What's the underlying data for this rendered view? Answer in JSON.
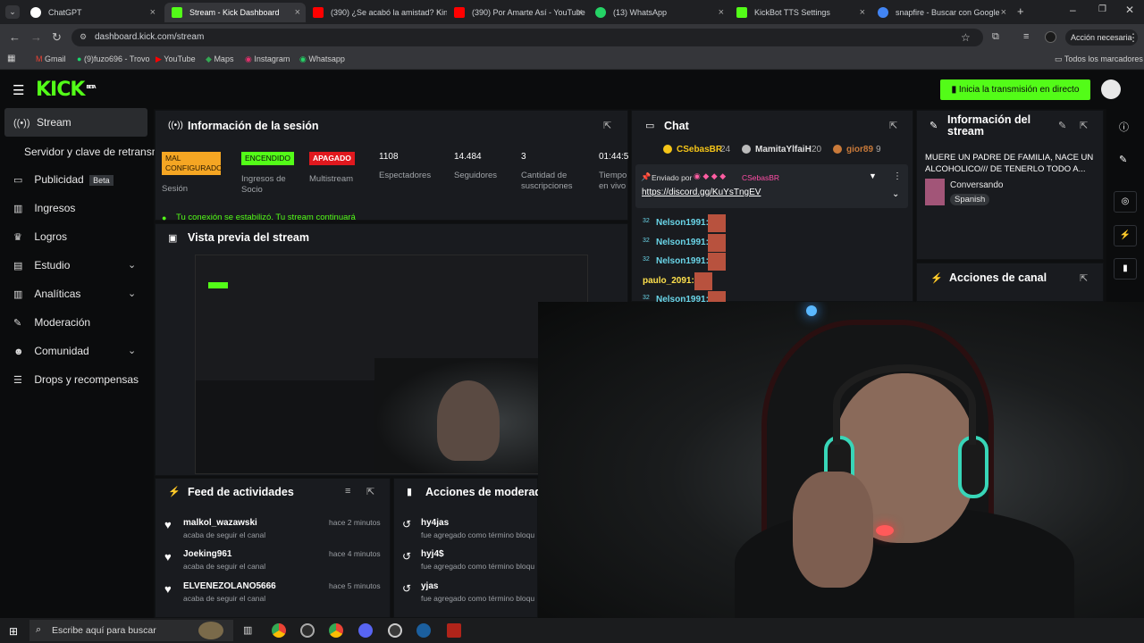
{
  "browser": {
    "tabs": [
      {
        "label": "ChatGPT",
        "color": "#cccccc"
      },
      {
        "label": "Stream - Kick Dashboard",
        "color": "#53fc18"
      },
      {
        "label": "(390) ¿Se acabó la amistad? Kin",
        "color": "#ff0000"
      },
      {
        "label": "(390) Por Amarte Así - YouTube",
        "color": "#ff0000"
      },
      {
        "label": "(13) WhatsApp",
        "color": "#25d366"
      },
      {
        "label": "KickBot TTS Settings",
        "color": "#53fc18"
      },
      {
        "label": "snapfire - Buscar con Google",
        "color": "#4285f4"
      }
    ],
    "url": "dashboard.kick.com/stream",
    "profile_button": "Acción necesaria",
    "bookmarks": [
      "Gmail",
      "(9)fuzo696 - Trovo",
      "YouTube",
      "Maps",
      "Instagram",
      "Whatsapp"
    ],
    "all_bookmarks": "Todos los marcadores"
  },
  "header": {
    "logo": "KICK",
    "logo_tag": "BETA",
    "go_live": "Inicia la transmisión en directo"
  },
  "sidebar": {
    "items": [
      {
        "label": "Stream",
        "icon": "broadcast-icon"
      },
      {
        "label": "Servidor y clave de retransm",
        "icon": ""
      },
      {
        "label": "Publicidad",
        "icon": "ad-icon",
        "badge": "Beta"
      },
      {
        "label": "Ingresos",
        "icon": "chart-icon"
      },
      {
        "label": "Logros",
        "icon": "trophy-icon"
      },
      {
        "label": "Estudio",
        "icon": "studio-icon"
      },
      {
        "label": "Analíticas",
        "icon": "analytics-icon"
      },
      {
        "label": "Moderación",
        "icon": "wrench-icon"
      },
      {
        "label": "Comunidad",
        "icon": "community-icon"
      },
      {
        "label": "Drops y recompensas",
        "icon": "drops-icon"
      }
    ]
  },
  "session": {
    "title": "Información de la sesión",
    "status": [
      {
        "badge": "MAL CONFIGURADO",
        "label": "Sesión"
      },
      {
        "badge": "ENCENDIDO",
        "label": "Ingresos de Socio"
      },
      {
        "badge": "APAGADO",
        "label": "Multistream"
      }
    ],
    "stats": [
      {
        "value": "1108",
        "label": "Espectadores"
      },
      {
        "value": "14.484",
        "label": "Seguidores"
      },
      {
        "value": "3",
        "label": "Cantidad de suscripciones"
      },
      {
        "value": "01:44:5",
        "label": "Tiempo en vivo"
      }
    ],
    "connection": "Tu conexión se estabilizó. Tu stream continuará"
  },
  "preview": {
    "title": "Vista previa del stream"
  },
  "chat": {
    "title": "Chat",
    "top_gifters": [
      {
        "name": "CSebasBR",
        "count": "24"
      },
      {
        "name": "MamitaYlfaiH",
        "count": "20"
      },
      {
        "name": "gior89",
        "count": "9"
      }
    ],
    "pinned": {
      "sent_by": "Enviado por",
      "sender": "CSebasBR",
      "link": "https://discord.gg/KuYsTngEV"
    },
    "messages": [
      {
        "badge": "32",
        "user": "Nelson1991:"
      },
      {
        "badge": "32",
        "user": "Nelson1991:"
      },
      {
        "badge": "32",
        "user": "Nelson1991:"
      },
      {
        "badge": "",
        "user": "paulo_2091:"
      },
      {
        "badge": "32",
        "user": "Nelson1991:"
      }
    ]
  },
  "stream_info": {
    "title": "Información del stream",
    "stream_title": "MUERE UN PADRE DE FAMILIA, NACE UN ALCOHOLICO/// DE TENERLO TODO A...",
    "category": "Conversando",
    "language": "Spanish"
  },
  "channel_actions": {
    "title": "Acciones de canal"
  },
  "activity_feed": {
    "title": "Feed de actividades",
    "items": [
      {
        "user": "malkol_wazawski",
        "action": "acaba de seguir el canal",
        "time": "hace 2 minutos"
      },
      {
        "user": "Joeking961",
        "action": "acaba de seguir el canal",
        "time": "hace 4 minutos"
      },
      {
        "user": "ELVENEZOLANO5666",
        "action": "acaba de seguir el canal",
        "time": "hace 5 minutos"
      }
    ]
  },
  "mod_actions": {
    "title": "Acciones de moderad",
    "items": [
      {
        "term": "hy4jas",
        "desc": "fue agregado como término bloqu"
      },
      {
        "term": "hyj4$",
        "desc": "fue agregado como término bloqu"
      },
      {
        "term": "yjas",
        "desc": "fue agregado como término bloqu"
      }
    ]
  },
  "taskbar": {
    "search_placeholder": "Escribe aquí para buscar"
  }
}
